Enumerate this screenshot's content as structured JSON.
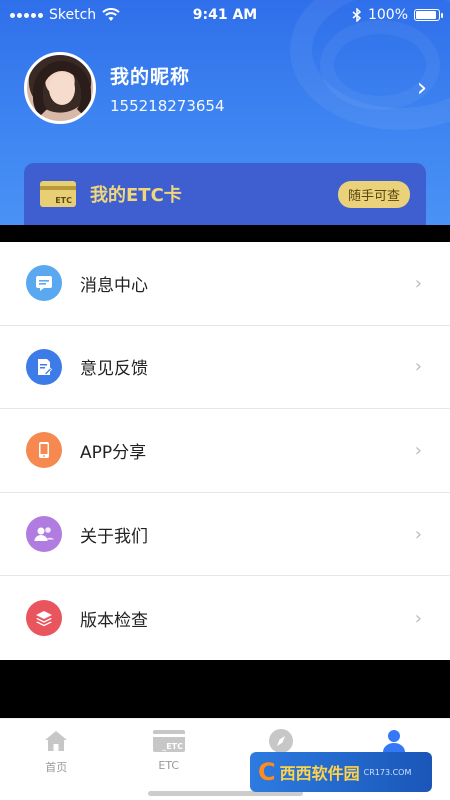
{
  "status_bar": {
    "carrier": "Sketch",
    "time": "9:41 AM",
    "battery": "100%"
  },
  "profile": {
    "nickname": "我的昵称",
    "phone": "15521827365​4"
  },
  "etc_card": {
    "icon_text": "ETC",
    "label": "我的ETC卡",
    "badge": "随手可查"
  },
  "menu": {
    "items": [
      {
        "label": "消息中心",
        "icon": "message-icon",
        "color": "#5aa8f0"
      },
      {
        "label": "意见反馈",
        "icon": "feedback-icon",
        "color": "#3d7be8"
      },
      {
        "label": "APP分享",
        "icon": "phone-share-icon",
        "color": "#f5894f"
      },
      {
        "label": "关于我们",
        "icon": "users-icon",
        "color": "#b07ce0"
      },
      {
        "label": "版本检查",
        "icon": "layers-icon",
        "color": "#e9555d"
      }
    ]
  },
  "tabbar": {
    "tabs": [
      {
        "label": "首页",
        "icon": "home-icon"
      },
      {
        "label": "ETC",
        "icon": "etc-card-icon"
      },
      {
        "label": "",
        "icon": "compass-icon"
      },
      {
        "label": "",
        "icon": "user-icon",
        "active": true
      }
    ]
  },
  "watermark": {
    "title": "西西软件园",
    "site": "CR173.COM"
  }
}
